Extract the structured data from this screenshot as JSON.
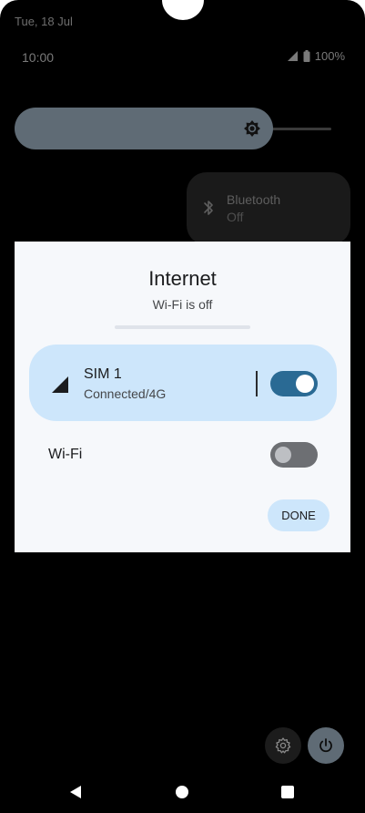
{
  "status_bar": {
    "date": "Tue, 18 Jul",
    "time": "10:00",
    "battery": "100%",
    "icons": [
      "signal-icon",
      "battery-icon"
    ]
  },
  "quick_settings": {
    "brightness_icon": "brightness-icon",
    "bluetooth": {
      "title": "Bluetooth",
      "state": "Off",
      "icon": "bluetooth-icon"
    },
    "settings_icon": "gear-icon",
    "power_icon": "power-icon"
  },
  "internet_dialog": {
    "title": "Internet",
    "subtitle": "Wi-Fi is off",
    "sim": {
      "name": "SIM 1",
      "status": "Connected/4G",
      "enabled": true,
      "icon": "cell-signal-icon"
    },
    "wifi": {
      "label": "Wi-Fi",
      "enabled": false
    },
    "done_label": "DONE"
  },
  "navigation": {
    "icons": [
      "back-icon",
      "home-icon",
      "recents-icon"
    ]
  },
  "colors": {
    "accent": "#2a6a94",
    "card_bg": "#cde6fb",
    "dialog_bg": "#f6f8fb",
    "brightness": "#5f6b75"
  }
}
